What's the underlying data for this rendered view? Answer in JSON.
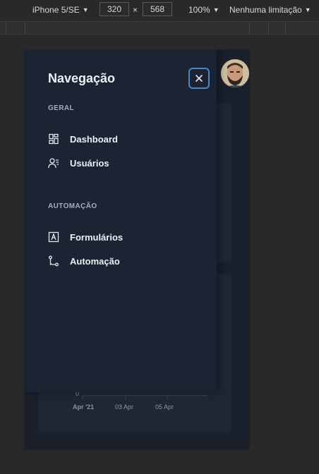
{
  "devtools": {
    "device": "iPhone 5/SE",
    "width": "320",
    "height": "568",
    "times": "×",
    "zoom": "100%",
    "throttling": "Nenhuma limitação"
  },
  "chart": {
    "y_tick": "0",
    "x_ticks": [
      "Apr '21",
      "03 Apr",
      "05 Apr"
    ]
  },
  "drawer": {
    "title": "Navegação",
    "sections": [
      {
        "title": "GERAL",
        "items": [
          {
            "label": "Dashboard",
            "icon": "dashboard-icon"
          },
          {
            "label": "Usuários",
            "icon": "users-icon"
          }
        ]
      },
      {
        "title": "AUTOMAÇÃO",
        "items": [
          {
            "label": "Formulários",
            "icon": "form-icon"
          },
          {
            "label": "Automação",
            "icon": "git-branch-icon"
          }
        ]
      }
    ]
  },
  "colors": {
    "background": "#1a202c",
    "drawer": "#1c2433",
    "accent_focus": "#4a86c8",
    "text": "#edf0f5",
    "muted": "#a0aec0"
  }
}
